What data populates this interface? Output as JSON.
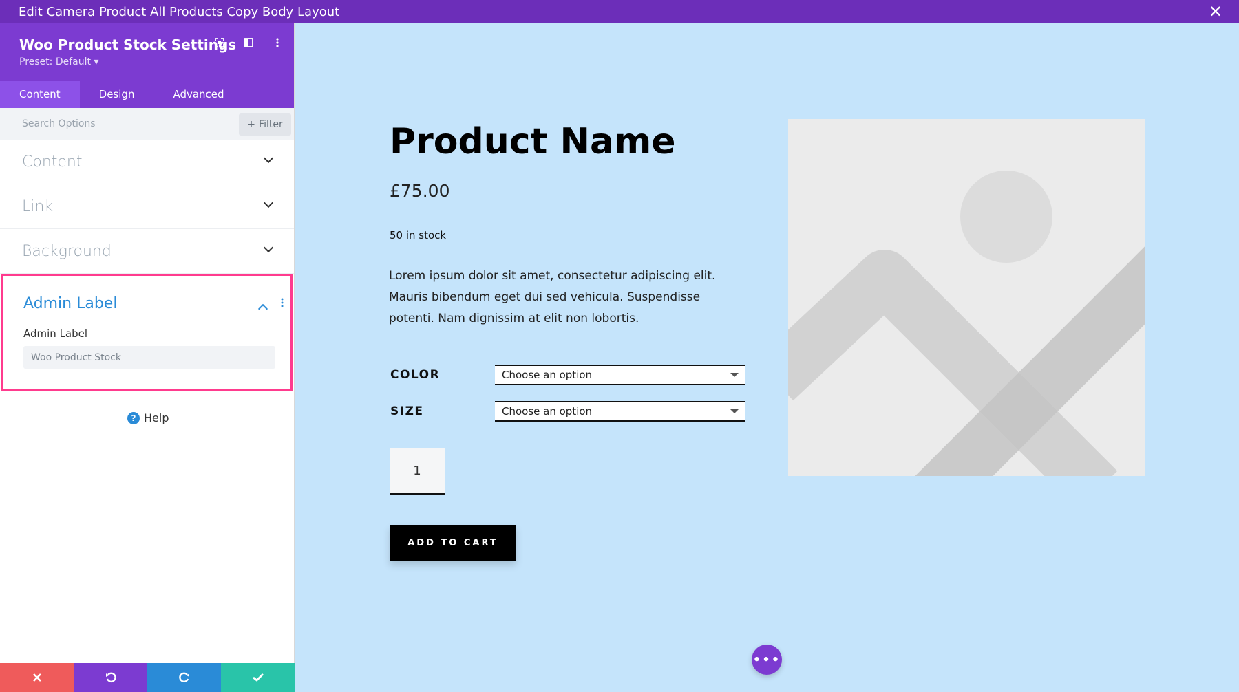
{
  "window": {
    "title": "Edit Camera Product All Products Copy Body Layout",
    "close_label": "✕"
  },
  "sidebar": {
    "title": "Woo Product Stock Settings",
    "preset": "Preset: Default ▾",
    "tabs": [
      {
        "label": "Content"
      },
      {
        "label": "Design"
      },
      {
        "label": "Advanced"
      }
    ],
    "search_placeholder": "Search Options",
    "filter_label": "Filter",
    "sections": [
      {
        "label": "Content"
      },
      {
        "label": "Link"
      },
      {
        "label": "Background"
      }
    ],
    "admin_label": {
      "section_label": "Admin Label",
      "field_label": "Admin Label",
      "field_value": "Woo Product Stock"
    },
    "help_label": "Help"
  },
  "product": {
    "name": "Product Name",
    "price": "£75.00",
    "stock": "50 in stock",
    "description": "Lorem ipsum dolor sit amet, consectetur adipiscing elit. Mauris bibendum eget dui sed vehicula. Suspendisse potenti. Nam dignissim at elit non lobortis.",
    "variations": [
      {
        "label": "COLOR",
        "selected": "Choose an option"
      },
      {
        "label": "SIZE",
        "selected": "Choose an option"
      }
    ],
    "quantity": "1",
    "add_to_cart": "ADD TO CART"
  },
  "colors": {
    "topbar": "#6c2eb9",
    "sidebar_header": "#7c3bd1",
    "canvas_bg": "#c5e4fb",
    "highlight": "#ff3b8e",
    "link_blue": "#2a8bd7"
  }
}
